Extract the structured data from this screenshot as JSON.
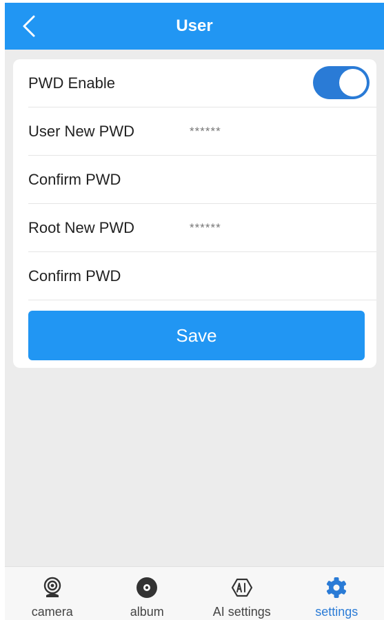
{
  "header": {
    "title": "User",
    "back_icon": "chevron-left-icon",
    "color": "#2196f3"
  },
  "form": {
    "pwd_enable": {
      "label": "PWD Enable",
      "checked": true
    },
    "user_new_pwd": {
      "label": "User New PWD",
      "value": "******"
    },
    "user_confirm_pwd": {
      "label": "Confirm PWD",
      "value": ""
    },
    "root_new_pwd": {
      "label": "Root New PWD",
      "value": "******"
    },
    "root_confirm_pwd": {
      "label": "Confirm PWD",
      "value": ""
    },
    "save_label": "Save"
  },
  "tabbar": {
    "active": "settings",
    "active_color": "#2a7bd6",
    "items": [
      {
        "id": "camera",
        "label": "camera",
        "icon": "webcam-icon"
      },
      {
        "id": "album",
        "label": "album",
        "icon": "disc-icon"
      },
      {
        "id": "ai",
        "label": "AI settings",
        "icon": "ai-icon"
      },
      {
        "id": "settings",
        "label": "settings",
        "icon": "gear-icon"
      }
    ]
  }
}
